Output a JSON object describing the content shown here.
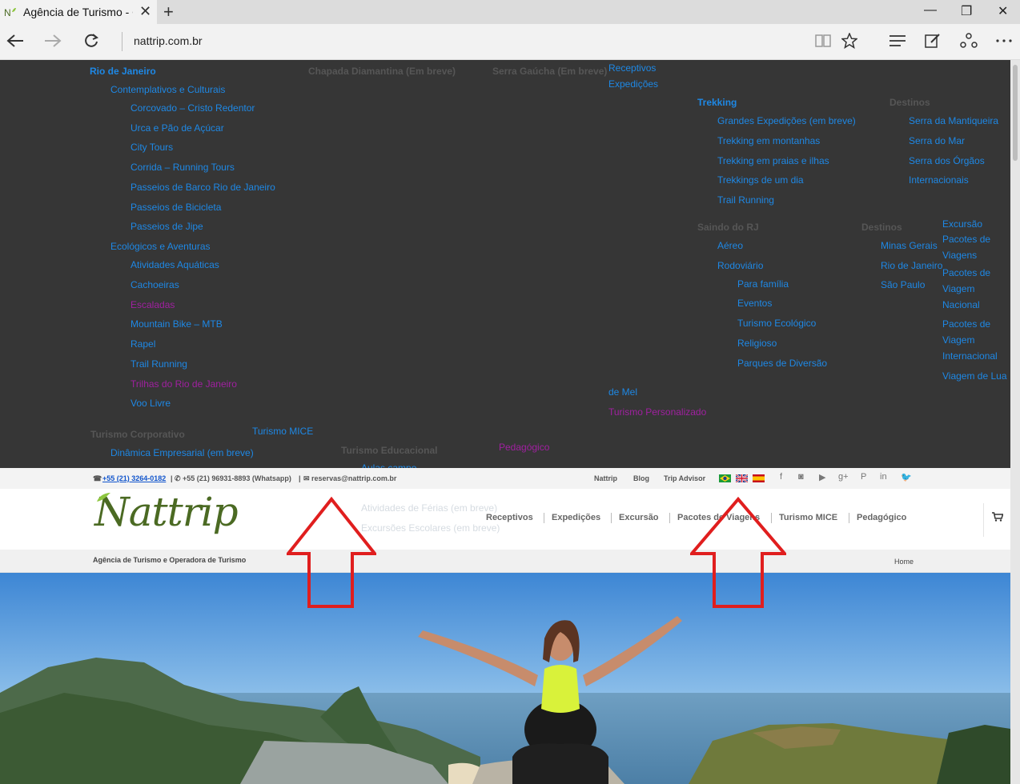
{
  "browser": {
    "tab_title": "Agência de Turismo - O",
    "tab_close": "✕",
    "new_tab": "+",
    "address": "nattrip.com.br",
    "win_min": "—",
    "win_max": "❐",
    "win_close": "✕"
  },
  "menu": {
    "col1": {
      "city": "Rio de Janeiro",
      "group1": "Contemplativos e Culturais",
      "group1_items": [
        "Corcovado – Cristo Redentor",
        "Urca e Pão de Açúcar",
        "City Tours",
        "Corrida – Running Tours",
        "Passeios de Barco Rio de Janeiro",
        "Passeios de Bicicleta",
        "Passeios de Jipe"
      ],
      "group2": "Ecológicos e Aventuras",
      "group2_items": [
        "Atividades Aquáticas",
        "Cachoeiras",
        "Escaladas",
        "Mountain Bike – MTB",
        "Rapel",
        "Trail Running",
        "Trilhas do Rio de Janeiro",
        "Voo Livre"
      ],
      "corp": "Turismo Corporativo",
      "corp_item": "Dinâmica Empresarial (em breve)",
      "mice": "Turismo MICE"
    },
    "col2": {
      "chapada": "Chapada Diamantina (Em breve)",
      "serra": "Serra Gaúcha (Em breve)",
      "educ": "Turismo Educacional",
      "pedag": "Pedagógico",
      "aulas": "Aulas campo"
    },
    "col3": {
      "receptivos": "Receptivos",
      "expedicoes": "Expedições",
      "trekking": "Trekking",
      "trek_items": [
        "Grandes Expedições (em breve)",
        "Trekking em montanhas",
        "Trekking em praias e ilhas",
        "Trekkings de um dia",
        "Trail Running"
      ],
      "destinos1": "Destinos",
      "dest1_items": [
        "Serra da Mantiqueira",
        "Serra do Mar",
        "Serra dos Órgãos",
        "Internacionais"
      ],
      "saindo": "Saindo do RJ",
      "aereo": "Aéreo",
      "rodoviario": "Rodoviário",
      "rod_items": [
        "Para família",
        "Eventos",
        "Turismo Ecológico",
        "Religioso",
        "Parques de Diversão"
      ],
      "destinos2": "Destinos",
      "dest2_items": [
        "Minas Gerais",
        "Rio de Janeiro",
        "São Paulo"
      ],
      "excursao": "Excursão",
      "pacotes_viagens": "Pacotes de Viagens",
      "pacotes_nacional": "Pacotes de Viagem Nacional",
      "pacotes_intl": "Pacotes de Viagem Internacional",
      "lua": "Viagem de Lua",
      "demel": "de Mel",
      "personalizado": "Turismo Personalizado"
    },
    "ghost_items": [
      "Atividades de Férias (em breve)",
      "Excursões Escolares (em breve)"
    ]
  },
  "topbar": {
    "phone_icon": "☎",
    "phone": "+55 (21) 3264-0182",
    "sep1": "|",
    "whatsapp": "✆ +55 (21) 96931-8893 (Whatsapp)",
    "sep2": "|",
    "email": "✉ reservas@nattrip.com.br",
    "links": [
      "Nattrip",
      "Blog",
      "Trip Advisor"
    ],
    "social": [
      "f",
      "◙",
      "▶",
      "g+",
      "P",
      "in",
      "🐦"
    ]
  },
  "header": {
    "logo": "Nattrip",
    "nav": [
      "Receptivos",
      "Expedições",
      "Excursão",
      "Pacotes de Viagens",
      "Turismo MICE",
      "Pedagógico"
    ],
    "cart_icon": "🛒"
  },
  "subbar": {
    "tagline": "Agência de Turismo e Operadora de Turismo",
    "breadcrumb": "Home"
  },
  "colors": {
    "menu_bg": "#363636",
    "menu_link": "#1e88e5",
    "logo_green": "#4b6a23",
    "arrow_red": "#e01e1e"
  }
}
